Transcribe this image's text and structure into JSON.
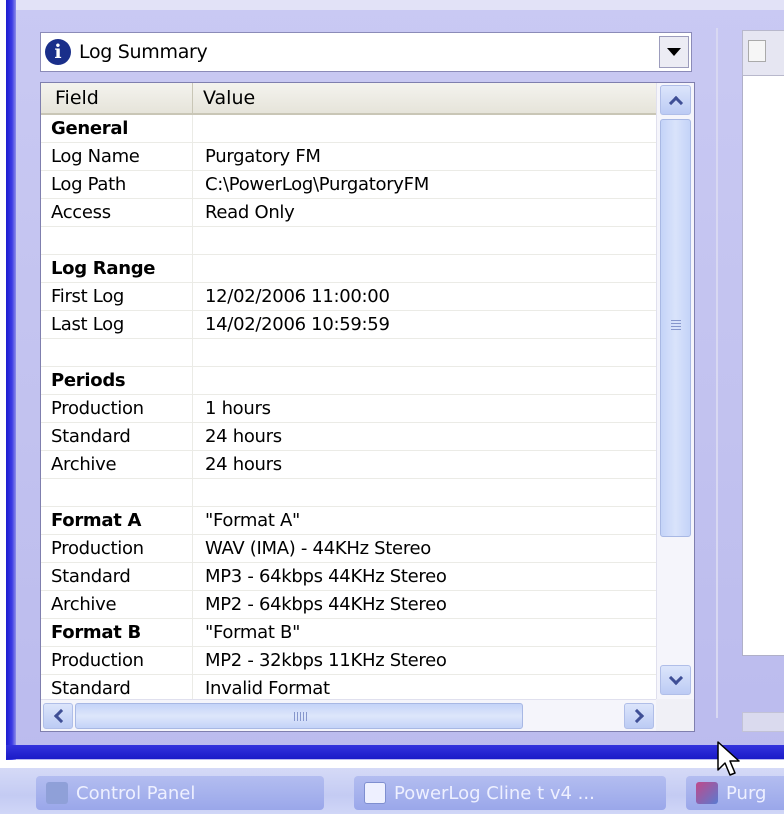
{
  "panel": {
    "dropdown": {
      "selected": "Log Summary",
      "icon": "info-icon"
    }
  },
  "grid": {
    "columns": [
      "Field",
      "Value"
    ],
    "rows": [
      {
        "field": "General",
        "value": "",
        "section": true
      },
      {
        "field": "Log Name",
        "value": "Purgatory FM"
      },
      {
        "field": "Log Path",
        "value": "C:\\PowerLog\\PurgatoryFM"
      },
      {
        "field": "Access",
        "value": "Read Only"
      },
      {
        "field": "",
        "value": ""
      },
      {
        "field": "Log Range",
        "value": "",
        "section": true
      },
      {
        "field": "First Log",
        "value": "12/02/2006 11:00:00"
      },
      {
        "field": "Last Log",
        "value": "14/02/2006 10:59:59"
      },
      {
        "field": "",
        "value": ""
      },
      {
        "field": "Periods",
        "value": "",
        "section": true
      },
      {
        "field": "Production",
        "value": "1 hours"
      },
      {
        "field": "Standard",
        "value": "24 hours"
      },
      {
        "field": "Archive",
        "value": "24 hours"
      },
      {
        "field": "",
        "value": ""
      },
      {
        "field": "Format A",
        "value": "\"Format A\"",
        "section": true
      },
      {
        "field": "Production",
        "value": "WAV (IMA) - 44KHz Stereo"
      },
      {
        "field": "Standard",
        "value": "MP3 - 64kbps 44KHz Stereo"
      },
      {
        "field": "Archive",
        "value": "MP2 - 64kbps 44KHz Stereo"
      },
      {
        "field": "Format B",
        "value": "\"Format B\"",
        "section": true
      },
      {
        "field": "Production",
        "value": "MP2 - 32kbps 11KHz Stereo"
      },
      {
        "field": "Standard",
        "value": "Invalid Format"
      }
    ]
  },
  "taskbar": {
    "items": [
      {
        "label": "Control Panel",
        "icon": "control-panel-icon"
      },
      {
        "label": "PowerLog Cline t v4 ...",
        "icon": "document-icon"
      },
      {
        "label": "Purg",
        "icon": "app-icon"
      }
    ]
  },
  "colors": {
    "window_bg": "#c6c6f2",
    "frame_edge": "#2a2ad8",
    "scrollbar": "#c4d3f8",
    "header_bg": "#ece9d8"
  }
}
